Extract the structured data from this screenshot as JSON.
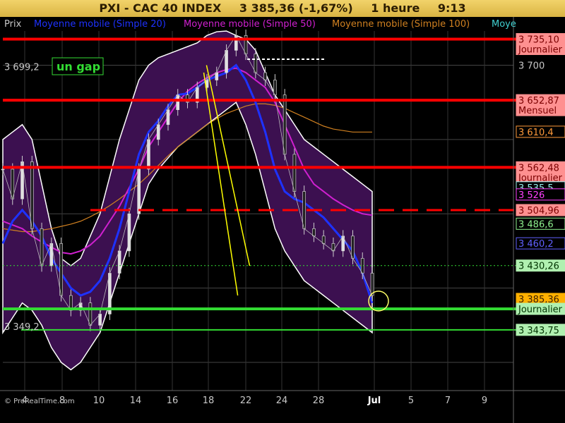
{
  "header": {
    "title": "PXI - CAC 40 INDEX",
    "price": "3 385,36 (-1,67%)",
    "interval": "1 heure",
    "time": "9:13"
  },
  "legend": {
    "prix": "Prix",
    "ma20": "Moyenne mobile (Simple 20)",
    "ma50": "Moyenne mobile (Simple 50)",
    "ma100": "Moyenne mobile (Simple 100)",
    "cut": "Moye"
  },
  "annotation_gap": "un gap",
  "watermark": "© ProRealTime.com",
  "colors": {
    "background": "#000000",
    "bollinger_fill": "#3c1050",
    "candles": "#cfcfcf",
    "ma20": "#1e32ff",
    "ma50": "#d020d0",
    "ma100": "#d08020",
    "red_level": "#ff0000",
    "green_level": "#33dd33",
    "trend": "#ffff00"
  },
  "chart_data": {
    "type": "line",
    "title": "PXI - CAC 40 INDEX",
    "ylim": [
      3262,
      3746
    ],
    "y_ticks": [
      3300,
      3400,
      3500,
      3600,
      3700
    ],
    "x_ticks": [
      "4",
      "8",
      "10",
      "14",
      "16",
      "18",
      "22",
      "24",
      "28",
      "Jul",
      "5",
      "7",
      "9"
    ],
    "grid": true,
    "left_labels": [
      {
        "text": "3 699,2",
        "value": 3699.2
      },
      {
        "text": "3 349,2",
        "value": 3349.2
      }
    ],
    "price_labels": [
      {
        "text": "3 735,10",
        "sub": "Journalier",
        "value": 3735.1,
        "bg": "#ff9090",
        "fg": "#7a0000"
      },
      {
        "text": "3 700",
        "value": 3700,
        "bg": "none",
        "fg": "#c8c8c8"
      },
      {
        "text": "3 652,87",
        "sub": "Mensuel",
        "value": 3652.87,
        "bg": "#ff9090",
        "fg": "#7a0000"
      },
      {
        "text": "3 610,4",
        "value": 3610.4,
        "bg": "#000000",
        "fg": "#ff9a3a",
        "border": "#ff9a3a"
      },
      {
        "text": "3 562,48",
        "sub": "Journalier",
        "value": 3562.48,
        "bg": "#ff9090",
        "fg": "#7a0000"
      },
      {
        "text": "3 535,5",
        "value": 3535.5,
        "bg": "#000000",
        "fg": "#9ee",
        "border": "#9ee"
      },
      {
        "text": "3 526",
        "value": 3526,
        "bg": "#000000",
        "fg": "#ff40ff",
        "border": "#ff40ff"
      },
      {
        "text": "3 504,96",
        "value": 3504.96,
        "bg": "#ff9090",
        "fg": "#7a0000"
      },
      {
        "text": "3 486,6",
        "value": 3486.6,
        "bg": "#000000",
        "fg": "#8ef08e",
        "border": "#8ef08e"
      },
      {
        "text": "3 460,2",
        "value": 3460.2,
        "bg": "#000000",
        "fg": "#6060ff",
        "border": "#6060ff"
      },
      {
        "text": "3 430,26",
        "value": 3430.26,
        "bg": "#b0f0b0",
        "fg": "#003300"
      },
      {
        "text": "3 385,36",
        "value": 3385.36,
        "bg": "#ffb000",
        "fg": "#3a1f00"
      },
      {
        "text": "Journalier",
        "value": 3372.0,
        "bg": "#b0f0b0",
        "fg": "#003300"
      },
      {
        "text": "3 343,75",
        "value": 3343.75,
        "bg": "#b0f0b0",
        "fg": "#003300"
      }
    ],
    "levels": [
      {
        "name": "resistance-3735",
        "value": 3735.1,
        "color": "#ff0000",
        "style": "solid"
      },
      {
        "name": "resistance-3653",
        "value": 3652.87,
        "color": "#ff0000",
        "style": "solid"
      },
      {
        "name": "resistance-3562",
        "value": 3562.48,
        "color": "#ff0000",
        "style": "solid"
      },
      {
        "name": "level-3505",
        "value": 3504.96,
        "color": "#ff0000",
        "style": "dashed"
      },
      {
        "name": "support-3372",
        "value": 3372.0,
        "color": "#33dd33",
        "style": "solid"
      },
      {
        "name": "support-3344",
        "value": 3343.75,
        "color": "#33dd33",
        "style": "solid"
      },
      {
        "name": "level-3430",
        "value": 3430.26,
        "color": "#33dd33",
        "style": "dotted"
      }
    ],
    "series": [
      {
        "name": "Prix",
        "key": "price",
        "values": [
          3560,
          3520,
          3570,
          3480,
          3430,
          3460,
          3390,
          3370,
          3380,
          3350,
          3365,
          3420,
          3450,
          3500,
          3560,
          3600,
          3620,
          3640,
          3660,
          3650,
          3670,
          3680,
          3690,
          3720,
          3740,
          3715,
          3690,
          3680,
          3660,
          3580,
          3530,
          3480,
          3470,
          3460,
          3450,
          3470,
          3440,
          3420,
          3390
        ]
      },
      {
        "name": "Moyenne mobile (Simple 20)",
        "key": "ma20",
        "values": [
          3460,
          3490,
          3505,
          3490,
          3470,
          3440,
          3420,
          3400,
          3390,
          3395,
          3410,
          3440,
          3480,
          3530,
          3580,
          3610,
          3625,
          3645,
          3660,
          3662,
          3670,
          3680,
          3685,
          3690,
          3700,
          3680,
          3650,
          3610,
          3560,
          3530,
          3520,
          3515,
          3505,
          3495,
          3480,
          3465,
          3450,
          3420,
          3380
        ]
      },
      {
        "name": "Moyenne mobile (Simple 50)",
        "key": "ma50",
        "values": [
          3490,
          3485,
          3480,
          3470,
          3462,
          3455,
          3448,
          3446,
          3450,
          3458,
          3470,
          3490,
          3510,
          3535,
          3560,
          3590,
          3610,
          3630,
          3650,
          3665,
          3675,
          3683,
          3690,
          3694,
          3696,
          3690,
          3680,
          3670,
          3650,
          3620,
          3590,
          3560,
          3540,
          3530,
          3520,
          3512,
          3505,
          3500,
          3498
        ]
      },
      {
        "name": "Moyenne mobile (Simple 100)",
        "key": "ma100",
        "values": [
          3480,
          3478,
          3476,
          3476,
          3478,
          3480,
          3483,
          3486,
          3490,
          3496,
          3503,
          3511,
          3520,
          3530,
          3540,
          3552,
          3565,
          3578,
          3590,
          3600,
          3610,
          3620,
          3628,
          3635,
          3640,
          3645,
          3648,
          3648,
          3646,
          3642,
          3636,
          3630,
          3624,
          3618,
          3614,
          3612,
          3610,
          3610,
          3610
        ]
      },
      {
        "name": "Bollinger upper",
        "key": "bb_upper",
        "values": [
          3600,
          3610,
          3620,
          3600,
          3540,
          3480,
          3440,
          3430,
          3440,
          3470,
          3500,
          3550,
          3600,
          3640,
          3680,
          3700,
          3710,
          3715,
          3720,
          3725,
          3730,
          3740,
          3745,
          3746,
          3740,
          3735,
          3720,
          3690,
          3660,
          3640,
          3620,
          3600,
          3590,
          3580,
          3570,
          3560,
          3550,
          3540,
          3530
        ]
      },
      {
        "name": "Bollinger lower",
        "key": "bb_lower",
        "values": [
          3340,
          3360,
          3380,
          3370,
          3350,
          3320,
          3300,
          3290,
          3300,
          3320,
          3340,
          3380,
          3420,
          3460,
          3500,
          3540,
          3560,
          3575,
          3590,
          3600,
          3610,
          3620,
          3630,
          3640,
          3650,
          3620,
          3580,
          3530,
          3480,
          3450,
          3430,
          3410,
          3400,
          3390,
          3380,
          3370,
          3360,
          3350,
          3340
        ]
      }
    ],
    "trendlines": [
      {
        "name": "trendline-1",
        "from": [
          23.5,
          3690
        ],
        "to": [
          27.2,
          3390
        ]
      },
      {
        "name": "trendline-2",
        "from": [
          23.8,
          3700
        ],
        "to": [
          28.5,
          3430
        ]
      }
    ]
  }
}
